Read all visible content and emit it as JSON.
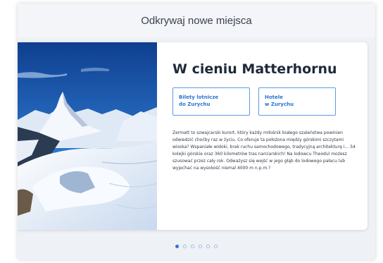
{
  "header": {
    "title": "Odkrywaj nowe miejsca"
  },
  "slide": {
    "title": "W cieniu Matterhornu",
    "buttons": [
      {
        "line1": "Bilety lotnicze",
        "line2": "do Zurychu"
      },
      {
        "line1": "Hotele",
        "line2": "w Zurychu"
      }
    ],
    "description": "Zermatt to szwajcarski kurort, który każdy miłośnik białego szaleństwa powinien odwiedzić choćby raz w życiu. Co oferuje ta położona między górskimi szczytami wioska? Wspaniałe widoki, brak ruchu samochodowego, tradycyjną architekturę i… 54 kolejki górskie oraz 360 kilometrów tras narciarskich! Na lodowcu Theodul możesz szusować przez cały rok. Odważysz się wejść w jego głąb do lodowego pałacu lub wyjechać na wysokość niemal 4000 m n.p.m.?"
  },
  "carousel": {
    "total": 6,
    "active": 1
  },
  "colors": {
    "accent": "#2a74d6",
    "sky": "#1d5fb8",
    "snow": "#eef3fa"
  },
  "icons": [
    "photo-matterhorn"
  ]
}
